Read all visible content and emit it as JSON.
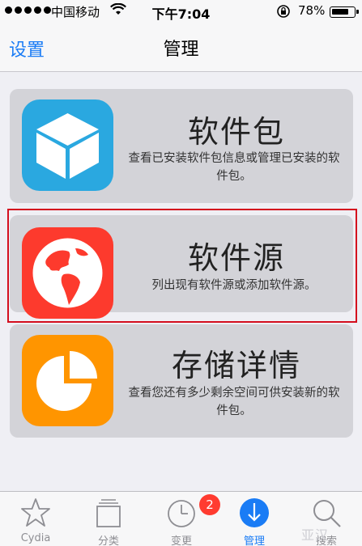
{
  "status_bar": {
    "carrier": "中国移动",
    "time": "下午7:04",
    "battery": "78%"
  },
  "nav": {
    "back_label": "设置",
    "title": "管理"
  },
  "cards": [
    {
      "title": "软件包",
      "description": "查看已安装软件包信息或管理已安装的软件包。",
      "icon": "package-icon",
      "icon_color": "#2aa8e0"
    },
    {
      "title": "软件源",
      "description": "列出现有软件源或添加软件源。",
      "icon": "globe-icon",
      "icon_color": "#fd3a2d"
    },
    {
      "title": "存储详情",
      "description": "查看您还有多少剩余空间可供安装新的软件包。",
      "icon": "pie-chart-icon",
      "icon_color": "#ff9500"
    }
  ],
  "tabs": [
    {
      "label": "Cydia",
      "icon": "star-icon"
    },
    {
      "label": "分类",
      "icon": "sections-icon"
    },
    {
      "label": "变更",
      "icon": "clock-icon",
      "badge": "2"
    },
    {
      "label": "管理",
      "icon": "download-icon",
      "active": true
    },
    {
      "label": "搜索",
      "icon": "search-icon"
    }
  ],
  "watermark": "亚汉",
  "colors": {
    "accent": "#1a7cf5",
    "highlight": "#d40e1e",
    "badge": "#ff3b30"
  }
}
